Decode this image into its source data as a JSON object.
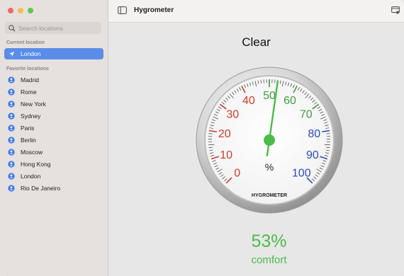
{
  "window": {
    "title": "Hygrometer"
  },
  "search": {
    "placeholder": "Search locations"
  },
  "sidebar": {
    "current_label": "Current location",
    "current": {
      "name": "London",
      "icon": "location-arrow-icon"
    },
    "favorites_label": "Favorite locations",
    "favorites": [
      {
        "name": "Madrid"
      },
      {
        "name": "Rome"
      },
      {
        "name": "New York"
      },
      {
        "name": "Sydney"
      },
      {
        "name": "Paris"
      },
      {
        "name": "Berlin"
      },
      {
        "name": "Moscow"
      },
      {
        "name": "Hong Kong"
      },
      {
        "name": "London"
      },
      {
        "name": "Rio De Janeiro"
      }
    ]
  },
  "main": {
    "condition": "Clear",
    "humidity_percent": "53%",
    "comfort_label": "comfort",
    "gauge": {
      "value": 53,
      "brand": "HYGROMETER",
      "unit": "%",
      "dial_labels": [
        "0",
        "10",
        "20",
        "30",
        "40",
        "50",
        "60",
        "70",
        "80",
        "90",
        "100"
      ],
      "colors": {
        "dry": "#d23a2a",
        "comfort": "#3f9b3f",
        "wet": "#2c49c4",
        "needle": "#48bd48"
      }
    }
  }
}
